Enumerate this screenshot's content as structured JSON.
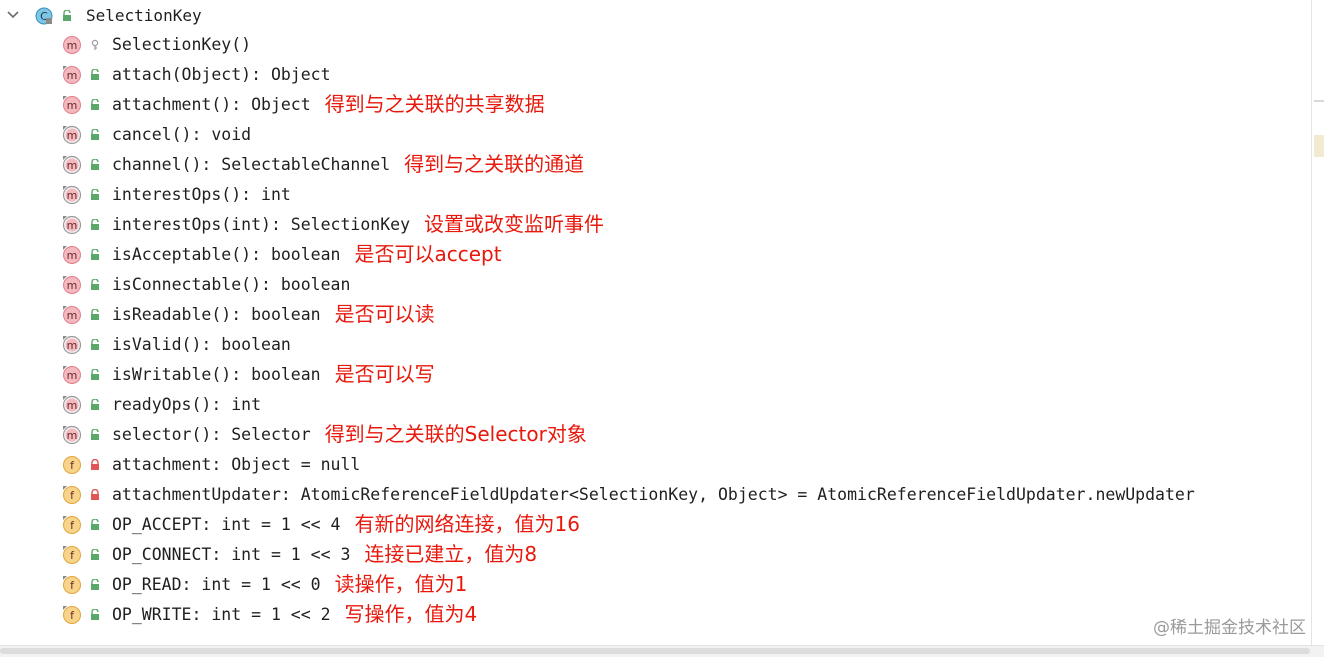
{
  "root": {
    "name": "SelectionKey",
    "icon": "class-icon"
  },
  "members": [
    {
      "kind": "m",
      "abstract": false,
      "vis": "package",
      "sig": "SelectionKey()",
      "note": ""
    },
    {
      "kind": "m",
      "abstract": false,
      "vis": "public",
      "sig": "attach(Object): Object",
      "note": ""
    },
    {
      "kind": "m",
      "abstract": false,
      "vis": "public",
      "sig": "attachment(): Object",
      "note": "得到与之关联的共享数据"
    },
    {
      "kind": "m",
      "abstract": true,
      "vis": "public",
      "sig": "cancel(): void",
      "note": ""
    },
    {
      "kind": "m",
      "abstract": true,
      "vis": "public",
      "sig": "channel(): SelectableChannel",
      "note": "得到与之关联的通道"
    },
    {
      "kind": "m",
      "abstract": true,
      "vis": "public",
      "sig": "interestOps(): int",
      "note": ""
    },
    {
      "kind": "m",
      "abstract": true,
      "vis": "public",
      "sig": "interestOps(int): SelectionKey",
      "note": "设置或改变监听事件"
    },
    {
      "kind": "m",
      "abstract": false,
      "vis": "public",
      "sig": "isAcceptable(): boolean",
      "note": "是否可以accept"
    },
    {
      "kind": "m",
      "abstract": false,
      "vis": "public",
      "sig": "isConnectable(): boolean",
      "note": ""
    },
    {
      "kind": "m",
      "abstract": false,
      "vis": "public",
      "sig": "isReadable(): boolean",
      "note": "是否可以读"
    },
    {
      "kind": "m",
      "abstract": true,
      "vis": "public",
      "sig": "isValid(): boolean",
      "note": ""
    },
    {
      "kind": "m",
      "abstract": false,
      "vis": "public",
      "sig": "isWritable(): boolean",
      "note": "是否可以写"
    },
    {
      "kind": "m",
      "abstract": true,
      "vis": "public",
      "sig": "readyOps(): int",
      "note": ""
    },
    {
      "kind": "m",
      "abstract": true,
      "vis": "public",
      "sig": "selector(): Selector",
      "note": "得到与之关联的Selector对象"
    },
    {
      "kind": "f",
      "abstract": false,
      "vis": "private",
      "sig": "attachment: Object = null",
      "note": ""
    },
    {
      "kind": "f",
      "abstract": false,
      "vis": "private",
      "sig": "attachmentUpdater: AtomicReferenceFieldUpdater<SelectionKey, Object> = AtomicReferenceFieldUpdater.newUpdater",
      "note": ""
    },
    {
      "kind": "f",
      "abstract": false,
      "vis": "public",
      "sig": "OP_ACCEPT: int = 1 << 4",
      "note": "有新的网络连接，值为16"
    },
    {
      "kind": "f",
      "abstract": false,
      "vis": "public",
      "sig": "OP_CONNECT: int = 1 << 3",
      "note": "连接已建立，值为8"
    },
    {
      "kind": "f",
      "abstract": false,
      "vis": "public",
      "sig": "OP_READ: int = 1 << 0",
      "note": "读操作，值为1"
    },
    {
      "kind": "f",
      "abstract": false,
      "vis": "public",
      "sig": "OP_WRITE: int = 1 << 2",
      "note": "写操作，值为4"
    }
  ],
  "watermark": "@稀土掘金技术社区",
  "colors": {
    "method_fill": "#f4b8bf",
    "method_stroke": "#e0808c",
    "field_fill": "#f7d48a",
    "field_stroke": "#e0a640",
    "public_lock": "#59a869",
    "private_lock": "#e05555",
    "note": "#e8180c"
  }
}
